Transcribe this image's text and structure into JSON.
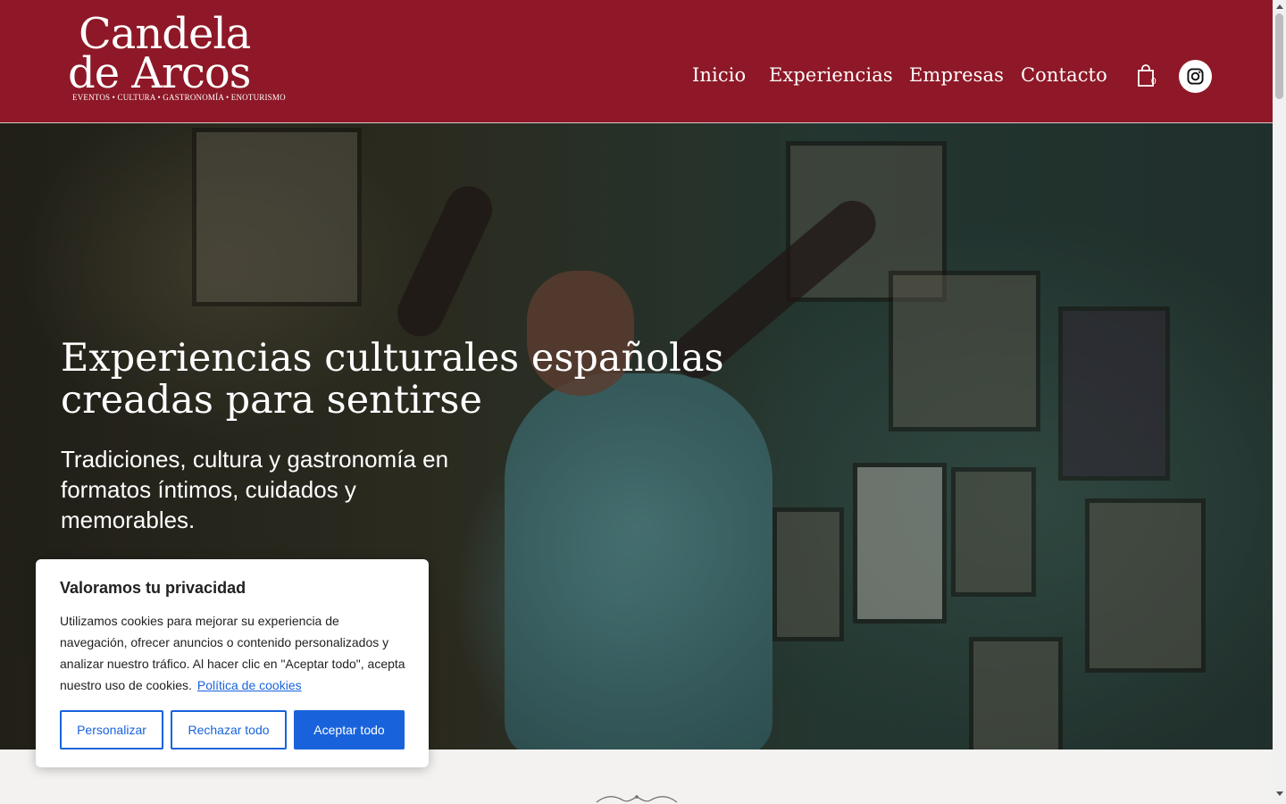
{
  "logo": {
    "line1": "Candela",
    "line2": "de Arcos",
    "tagline": "EVENTOS • CULTURA • GASTRONOMÍA • ENOTURISMO"
  },
  "nav": {
    "items": [
      {
        "label": "Inicio"
      },
      {
        "label": "Experiencias"
      },
      {
        "label": "Empresas"
      },
      {
        "label": "Contacto"
      }
    ],
    "cart_count": "0"
  },
  "hero": {
    "title": "Experiencias culturales españolas creadas para sentirse",
    "subtitle": "Tradiciones, cultura y gastronomía en formatos íntimos, cuidados y memorables."
  },
  "cookie_banner": {
    "title": "Valoramos tu privacidad",
    "text": "Utilizamos cookies para mejorar su experiencia de navegación, ofrecer anuncios o contenido personalizados y analizar nuestro tráfico. Al hacer clic en \"Aceptar todo\", acepta nuestro uso de cookies.",
    "link": "Política de cookies",
    "buttons": {
      "customize": "Personalizar",
      "reject": "Rechazar todo",
      "accept": "Aceptar todo"
    }
  },
  "colors": {
    "brand": "#8e1827",
    "cookie_accent": "#1863dc",
    "page_background": "#f3f2f0"
  },
  "icons": [
    "shopping-bag-icon",
    "instagram-icon",
    "ornament-icon"
  ]
}
